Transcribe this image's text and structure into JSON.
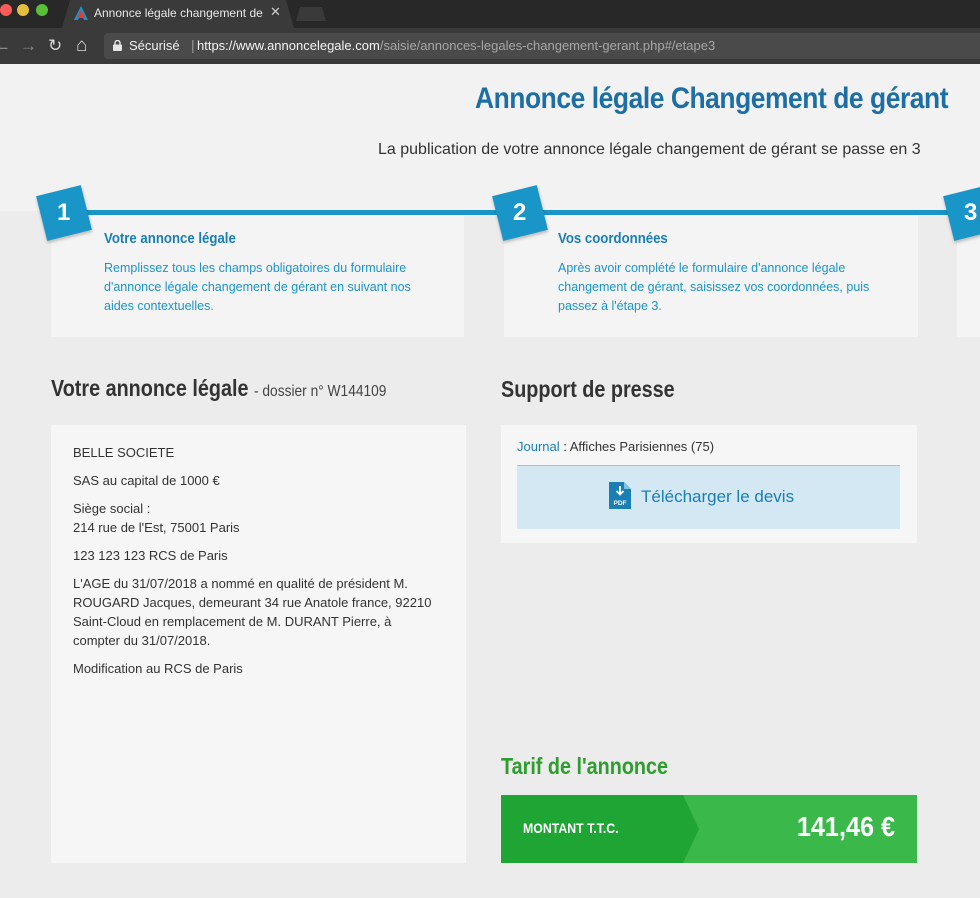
{
  "browser": {
    "tab_title": "Annonce légale changement de gérant",
    "tab_close": "✕",
    "secure_label": "Sécurisé",
    "url_separator": "|",
    "url_scheme_host": "https://www.annoncelegale.com",
    "url_path": "/saisie/annonces-legales-changement-gerant.php#/etape3",
    "nav_back": "←",
    "nav_forward": "→",
    "nav_reload": "↻",
    "nav_home": "⌂"
  },
  "header": {
    "title": "Annonce légale Changement de gérant",
    "subtitle": "La publication de votre annonce légale changement de gérant se passe en 3"
  },
  "steps": [
    {
      "number": "1",
      "title": "Votre annonce légale",
      "description": "Remplissez tous les champs obligatoires du formulaire d'annonce légale changement de gérant en suivant nos aides contextuelles."
    },
    {
      "number": "2",
      "title": "Vos coordonnées",
      "description": "Après avoir complété le formulaire d'annonce légale changement de gérant, saisissez vos coordonnées, puis passez à l'étape 3."
    },
    {
      "number": "3"
    }
  ],
  "annonce": {
    "title": "Votre annonce légale",
    "dossier": "- dossier n° W144109",
    "company": "BELLE SOCIETE",
    "capital": "SAS au capital de 1000 €",
    "siege_label": "Siège social :",
    "siege_address": "214 rue de l'Est, 75001 Paris",
    "rcs": "123 123 123 RCS de Paris",
    "body": "L'AGE du 31/07/2018 a nommé en qualité de président M. ROUGARD Jacques, demeurant 34 rue Anatole france, 92210 Saint-Cloud en remplacement de M. DURANT Pierre, à compter du 31/07/2018.",
    "modification": "Modification au RCS de Paris"
  },
  "support": {
    "title": "Support de presse",
    "journal_label": "Journal",
    "journal_sep": " : ",
    "journal_value": "Affiches Parisiennes (75)",
    "download_label": "Télécharger le devis",
    "pdf_text": "PDF"
  },
  "tarif": {
    "title": "Tarif de l'annonce",
    "label": "MONTANT T.T.C.",
    "amount": "141,46 €"
  },
  "colors": {
    "brand_blue": "#1a95c7",
    "title_blue": "#1d6fa3",
    "green_dark": "#1fa534",
    "green_light": "#3bb84a"
  }
}
